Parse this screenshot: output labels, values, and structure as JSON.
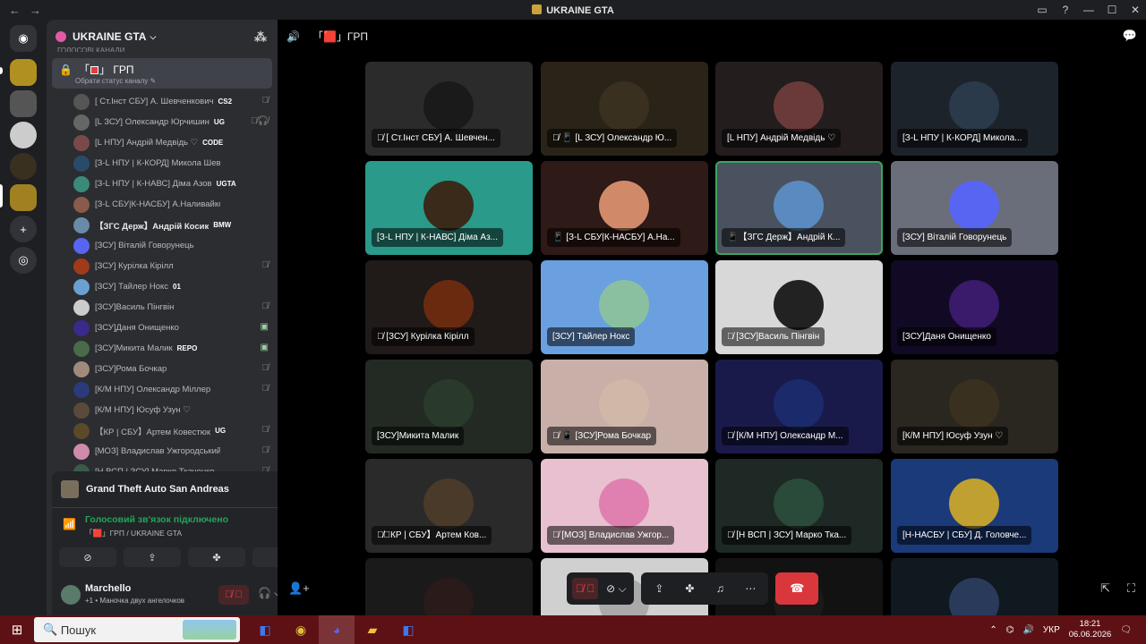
{
  "window": {
    "title": "UKRAINE GTA",
    "back_icon": "←",
    "forward_icon": "→"
  },
  "guild": {
    "name": "UKRAINE GTA",
    "category_cut": "ГОЛОСОВІ КАНАЛИ"
  },
  "channel": {
    "name": "ГРП",
    "prefix": "「",
    "suffix": "」",
    "sub": "Обрати статус каналу"
  },
  "members": [
    {
      "name": "[ Ст.Інст СБУ] А. Шевченкович",
      "tag": "CS2",
      "status": "mic-off",
      "color": "#555"
    },
    {
      "name": "[L ЗСУ] Олександр Юрчишин",
      "tag": "UG",
      "status": "mic-off-deaf",
      "color": "#666"
    },
    {
      "name": "[L НПУ] Андрій Медвідь ♡",
      "tag": "CODE",
      "status": "",
      "color": "#7a4a4a"
    },
    {
      "name": "[З-L НПУ | К-КОРД] Микола Шевчук",
      "tag": "",
      "status": "",
      "color": "#2a4a6a"
    },
    {
      "name": "[З-L НПУ | К-НАВС] Діма Азов",
      "tag": "UGTA",
      "status": "",
      "color": "#3a8a7a"
    },
    {
      "name": "[З-L СБУ|К-НАСБУ] А.Наливайко",
      "tag": "",
      "status": "",
      "color": "#8a5a4a"
    },
    {
      "name": "【ЗГС Держ】Андрій Косик",
      "tag": "BMW",
      "status": "",
      "color": "#6a8aaa",
      "bold": true
    },
    {
      "name": "[ЗСУ] Віталій Говорунець",
      "tag": "",
      "status": "",
      "color": "#5865f2"
    },
    {
      "name": "[ЗСУ] Курілка Кірілл",
      "tag": "",
      "status": "mic-off",
      "color": "#a03a1a"
    },
    {
      "name": "[ЗСУ] Тайлер Нокс",
      "tag": "01",
      "status": "",
      "color": "#6aa0d0"
    },
    {
      "name": "[ЗСУ]Василь Пінгвін",
      "tag": "",
      "status": "mic-off",
      "color": "#ccc"
    },
    {
      "name": "[ЗСУ]Даня Онищенко",
      "tag": "",
      "status": "cam",
      "color": "#3a2a8a"
    },
    {
      "name": "[ЗСУ]Микита Малик",
      "tag": "REPO",
      "status": "cam",
      "color": "#4a6a4a"
    },
    {
      "name": "[ЗСУ]Рома Бочкар",
      "tag": "",
      "status": "mic-off",
      "color": "#a08a7a"
    },
    {
      "name": "[К/М НПУ] Олександр Міллер",
      "tag": "",
      "status": "mic-off",
      "color": "#2a3a7a"
    },
    {
      "name": "[К/М НПУ] Юсуф Узун ♡",
      "tag": "",
      "status": "",
      "color": "#5a4a3a"
    },
    {
      "name": "【КР | СБУ】Артем Ковестюк",
      "tag": "UG",
      "status": "mic-off",
      "color": "#5a4a2a"
    },
    {
      "name": "[МОЗ] Владислав Ужгородський",
      "tag": "",
      "status": "mic-off",
      "color": "#d08aaa"
    },
    {
      "name": "[Н ВСП | ЗСУ] Марко Ткаченко",
      "tag": "",
      "status": "mic-off",
      "color": "#3a5a4a"
    }
  ],
  "activity": {
    "game": "Grand Theft Auto San Andreas",
    "voice_status": "Голосовий зв'язок підключено",
    "voice_location": "「🟥」ГРП / UKRAINE GTA"
  },
  "user": {
    "name": "Marchello",
    "status": "+1 • Маночка двух ангелочков"
  },
  "stage": {
    "channel_name": "「🟥」ГРП"
  },
  "tiles": [
    {
      "label": "🎙̸ [ Ст.Інст СБУ] А. Шевчен...",
      "bg": "#2b2b2b",
      "av": "#1a1a1a"
    },
    {
      "label": "🎙̸ 📱 [L ЗСУ] Олександр Ю...",
      "bg": "#2a2418",
      "av": "#3a3020"
    },
    {
      "label": "[L НПУ] Андрій Медвідь ♡",
      "bg": "#231d1d",
      "av": "#6a3a3a"
    },
    {
      "label": "[З-L НПУ | К-КОРД] Микола...",
      "bg": "#1d232a",
      "av": "#2a3a4a"
    },
    {
      "label": "[З-L НПУ | К-НАВС] Діма Аз...",
      "bg": "#2a9a8a",
      "av": "#3a2a1a"
    },
    {
      "label": "📱 [З-L СБУ|К-НАСБУ] А.На...",
      "bg": "#2e1a16",
      "av": "#d08a6a"
    },
    {
      "label": "📱【ЗГС Держ】Андрій К...",
      "bg": "#4a5260",
      "av": "#5a8ac0",
      "active": true
    },
    {
      "label": "[ЗСУ] Віталій Говорунець",
      "bg": "#6a6e7a",
      "av": "#5865f2"
    },
    {
      "label": "🎙̸ [ЗСУ] Курілка Кірілл",
      "bg": "#201a18",
      "av": "#6a2a10"
    },
    {
      "label": "[ЗСУ] Тайлер Нокс",
      "bg": "#6aa0e0",
      "av": "#8ac0a0"
    },
    {
      "label": "🎙̸ [ЗСУ]Василь Пінгвін",
      "bg": "#d8d8d8",
      "av": "#222"
    },
    {
      "label": "[ЗСУ]Даня Онищенко",
      "bg": "#120a24",
      "av": "#3a1a6a"
    },
    {
      "label": "[ЗСУ]Микита Малик",
      "bg": "#232a24",
      "av": "#2a3a2a"
    },
    {
      "label": "🎙̸ 📱 [ЗСУ]Рома Бочкар",
      "bg": "#c8b0a8",
      "av": "#d0b8a8"
    },
    {
      "label": "🎙̸ [К/М НПУ] Олександр М...",
      "bg": "#1a1a4a",
      "av": "#1a2a6a"
    },
    {
      "label": "[К/М НПУ] Юсуф Узун ♡",
      "bg": "#2a2620",
      "av": "#3a3020"
    },
    {
      "label": "🎙̸【КР | СБУ】Артем Ков...",
      "bg": "#2a2a2a",
      "av": "#4a3a2a"
    },
    {
      "label": "🎙̸ [МОЗ] Владислав Ужгор...",
      "bg": "#e8c0d0",
      "av": "#e080b0"
    },
    {
      "label": "🎙̸ [Н ВСП | ЗСУ] Марко Тка...",
      "bg": "#1e2824",
      "av": "#2a4a3a"
    },
    {
      "label": "[Н-НАСБУ | СБУ] Д. Головче...",
      "bg": "#1a3a7a",
      "av": "#c0a030"
    },
    {
      "label": "",
      "bg": "#1a1a1a",
      "av": "#2a1a1a"
    },
    {
      "label": "",
      "bg": "#d0d0d0",
      "av": "#aaa"
    },
    {
      "label": "",
      "bg": "#121212",
      "av": "#1a1a1a"
    },
    {
      "label": "",
      "bg": "#101820",
      "av": "#2a3a5a"
    }
  ],
  "taskbar": {
    "search_placeholder": "Пошук",
    "lang": "УКР",
    "time": "18:21",
    "date": "06.06.2026"
  }
}
